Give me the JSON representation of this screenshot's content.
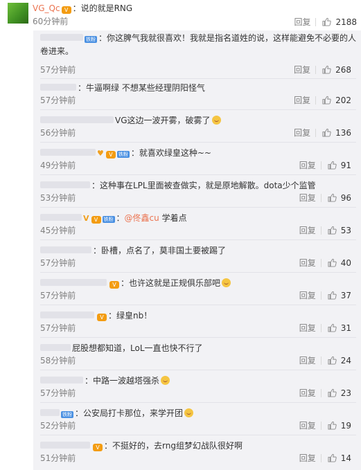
{
  "main_comment": {
    "user": "VG_Qc",
    "text": "：说的就是RNG",
    "time": "60分钟前",
    "reply_label": "回复",
    "likes": "2188"
  },
  "replies": [
    {
      "text": "：你这脾气我就很喜欢！我就是指名道姓的说，这样能避免不必要的人卷进来。",
      "time": "57分钟前",
      "reply_label": "回复",
      "likes": "268"
    },
    {
      "text": "：牛逼啊绿 不想某些经理阴阳怪气",
      "time": "57分钟前",
      "reply_label": "回复",
      "likes": "202"
    },
    {
      "text": "VG这边一波开雾，破雾了",
      "time": "56分钟前",
      "reply_label": "回复",
      "likes": "136"
    },
    {
      "badge": "铁粉",
      "text": "：就喜欢绿皇这种~~",
      "time": "49分钟前",
      "reply_label": "回复",
      "likes": "91"
    },
    {
      "text": "：这种事在LPL里面被查做实，就是原地解散。dota少个监管",
      "time": "53分钟前",
      "reply_label": "回复",
      "likes": "96"
    },
    {
      "badge": "铁粉",
      "text": "：",
      "mention": "@佟鑫cu",
      "text_after": " 学着点",
      "time": "45分钟前",
      "reply_label": "回复",
      "likes": "53"
    },
    {
      "text": "：卧槽，点名了，莫非国土要被踢了",
      "time": "57分钟前",
      "reply_label": "回复",
      "likes": "40"
    },
    {
      "text": "：也许这就是正规俱乐部吧",
      "time": "57分钟前",
      "reply_label": "回复",
      "likes": "37"
    },
    {
      "text": "：绿皇nb！",
      "time": "57分钟前",
      "reply_label": "回复",
      "likes": "31"
    },
    {
      "text": "屁股想都知道，LoL一直也快不行了",
      "time": "58分钟前",
      "reply_label": "回复",
      "likes": "24"
    },
    {
      "text": "：中路一波越塔强杀",
      "time": "57分钟前",
      "reply_label": "回复",
      "likes": "23"
    },
    {
      "badge": "铁粉",
      "text": "：公安局打卡那位，来学开团",
      "time": "52分钟前",
      "reply_label": "回复",
      "likes": "19"
    },
    {
      "text": "：不挺好的，去rng组梦幻战队很好啊",
      "time": "51分钟前",
      "reply_label": "回复",
      "likes": "14"
    }
  ],
  "icons": {
    "thumb": "thumbs-up-icon",
    "vip": "vip-badge-icon"
  },
  "colors": {
    "username": "#eb7350",
    "muted": "#808080",
    "reply_bg": "#f2f2f5"
  }
}
